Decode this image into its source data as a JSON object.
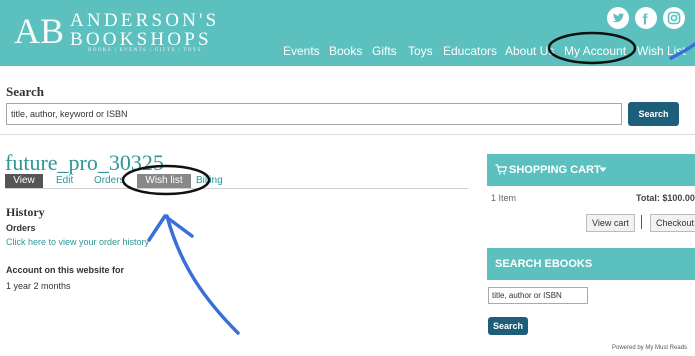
{
  "header": {
    "logo_monogram": "AB",
    "logo_line1": "ANDERSON'S",
    "logo_line2": "BOOKSHOPS",
    "logo_tagline": "BOOKS | EVENTS | GIFTS | TOYS",
    "social": [
      {
        "name": "twitter",
        "icon": "twitter-icon"
      },
      {
        "name": "facebook",
        "icon": "facebook-icon",
        "glyph": "f"
      },
      {
        "name": "instagram",
        "icon": "instagram-icon"
      }
    ],
    "nav": [
      "Events",
      "Books",
      "Gifts",
      "Toys",
      "Educators",
      "About Us",
      "My Account",
      "Wish List"
    ]
  },
  "search": {
    "heading": "Search",
    "placeholder": "title, author, keyword or ISBN",
    "button": "Search"
  },
  "account": {
    "username": "future_pro_30325",
    "tabs": [
      "View",
      "Edit",
      "Orders",
      "Wish list",
      "Billing"
    ],
    "active_tab": "View",
    "history_heading": "History",
    "orders_heading": "Orders",
    "orders_link": "Click here to view your order history",
    "member_heading": "Account on this website for",
    "member_duration": "1 year 2 months"
  },
  "cart": {
    "title": "SHOPPING CART",
    "items": "1 Item",
    "total": "Total: $100.00",
    "view_cart": "View cart",
    "checkout": "Checkout"
  },
  "ebooks": {
    "title": "SEARCH EBOOKS",
    "placeholder": "title, author or ISBN",
    "button": "Search",
    "powered_by": "Powered by My Must Reads"
  },
  "annotations": {
    "highlighted": [
      "My Account",
      "Wish list"
    ],
    "ink_color": "#111111",
    "arrow_color": "#3a6fd8"
  },
  "colors": {
    "brand_teal": "#5bc0be",
    "link_teal": "#2e9696",
    "button_navy": "#1d5f7a"
  }
}
